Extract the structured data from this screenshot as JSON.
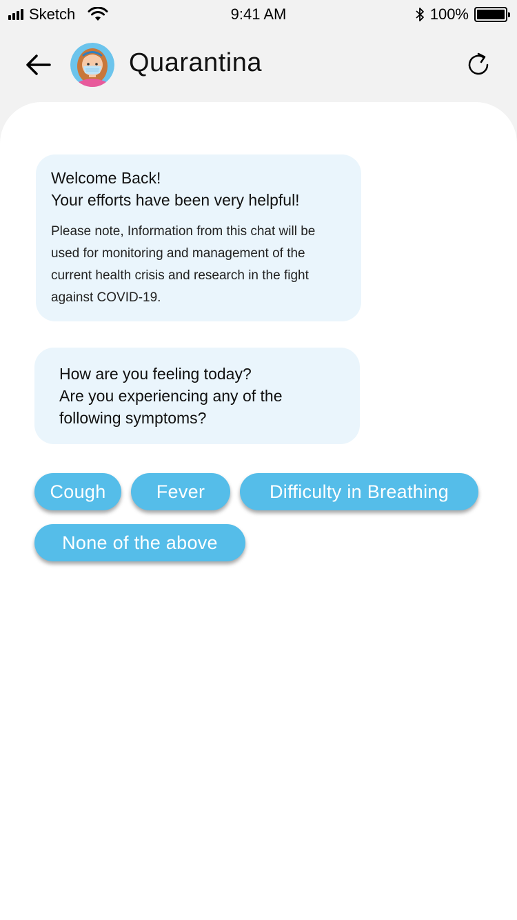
{
  "status_bar": {
    "carrier": "Sketch",
    "time": "9:41 AM",
    "battery": "100%"
  },
  "header": {
    "title": "Quarantina",
    "back_icon": "arrow-left-icon",
    "refresh_icon": "refresh-icon"
  },
  "messages": [
    {
      "lines": [
        "Welcome Back!",
        "Your efforts have been very helpful!"
      ],
      "note": "Please note, Information from this chat will be used for monitoring and management of the current health crisis and research in the fight against COVID-19."
    },
    {
      "lines": [
        "How are you feeling today?",
        "Are you experiencing any of the following symptoms?"
      ]
    }
  ],
  "options": [
    "Cough",
    "Fever",
    "Difficulty in Breathing",
    "None of the above"
  ],
  "colors": {
    "chip": "#55bde9",
    "bubble": "#eaf5fc",
    "header_bg": "#f2f2f2"
  }
}
